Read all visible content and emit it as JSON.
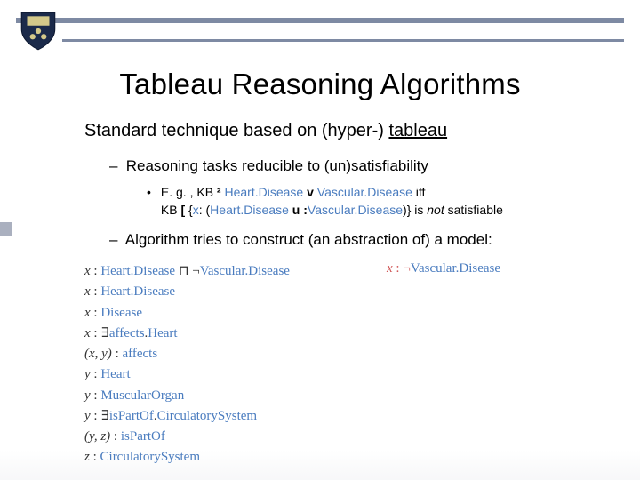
{
  "title": "Tableau Reasoning Algorithms",
  "line1_pre": "Standard technique based on (hyper-) ",
  "line1_u": "tableau",
  "line2_pre": "Reasoning tasks reducible to (un)",
  "line2_u": "satisfiability",
  "ex_lead": "E. g. , KB ",
  "ex_models": "²",
  "ex_hd": " Heart.Disease ",
  "ex_v": "v",
  "ex_vd": " Vascular.Disease ",
  "ex_iff": "iff",
  "ex_kb2": "KB ",
  "ex_lb": "[",
  "ex_brace": " {",
  "ex_x": "x",
  "ex_colon": ": (",
  "ex_hd2": "Heart.Disease ",
  "ex_u": "u",
  "ex_neg": " :",
  "ex_vd2": "Vascular.Disease",
  "ex_close": ")} is ",
  "ex_not": "not",
  "ex_sat": " satisfiable",
  "line3": "Algorithm tries to construct (an abstraction of) a model:",
  "m": {
    "r1a": "x",
    "r1b": " : ",
    "r1c": "Heart.Disease",
    "r1d": " ⊓ ¬",
    "r1e": "Vascular.Disease",
    "r2a": "x",
    "r2b": " : ",
    "r2c": "Heart.Disease",
    "r3a": "x",
    "r3b": " : ",
    "r3c": "Disease",
    "r4a": "x",
    "r4b": " : ∃",
    "r4c": "affects",
    "r4d": ".",
    "r4e": "Heart",
    "r5a": "(x, y)",
    "r5b": " : ",
    "r5c": "affects",
    "r6a": "y",
    "r6b": " : ",
    "r6c": "Heart",
    "r7a": "y",
    "r7b": " : ",
    "r7c": "MuscularOrgan",
    "r8a": "y",
    "r8b": " : ∃",
    "r8c": "isPartOf",
    "r8d": ".",
    "r8e": "CirculatorySystem",
    "r9a": "(y, z)",
    "r9b": " : ",
    "r9c": "isPartOf",
    "r10a": "z",
    "r10b": " : ",
    "r10c": "CirculatorySystem",
    "rnote_a": "x",
    "rnote_b": " : ¬",
    "rnote_c": "Vascular.Disease"
  }
}
